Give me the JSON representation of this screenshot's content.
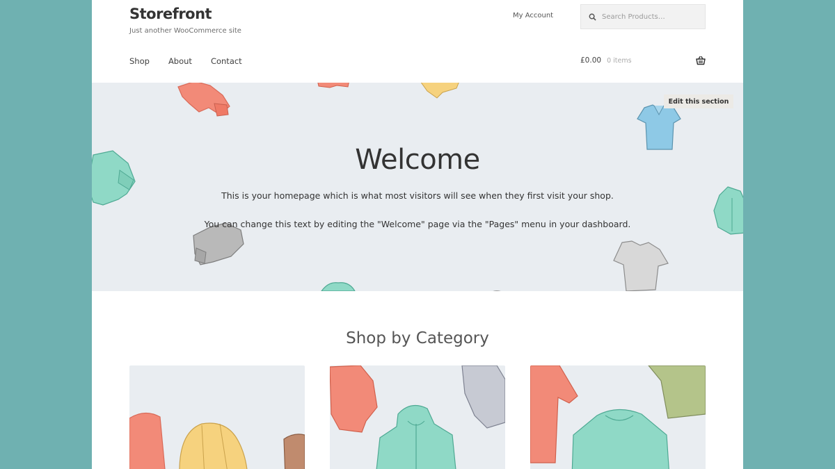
{
  "site": {
    "title": "Storefront",
    "tagline": "Just another WooCommerce site"
  },
  "header": {
    "my_account": "My Account",
    "search_placeholder": "Search Products…"
  },
  "nav": {
    "items": [
      "Shop",
      "About",
      "Contact"
    ]
  },
  "cart": {
    "amount": "£0.00",
    "count": "0 items"
  },
  "hero": {
    "edit_label": "Edit this section",
    "title": "Welcome",
    "line1": "This is your homepage which is what most visitors will see when they first visit your shop.",
    "line2": "You can change this text by editing the \"Welcome\" page via the \"Pages\" menu in your dashboard."
  },
  "categories": {
    "heading": "Shop by Category"
  },
  "colors": {
    "background": "#6fb1b1",
    "hero_bg": "#e9edf1",
    "coral": "#f28a78",
    "mint": "#8fd9c6",
    "yellow": "#f6d27e",
    "sky": "#8ec9e6",
    "grey": "#b9b9b9",
    "olive": "#b4c48a"
  }
}
